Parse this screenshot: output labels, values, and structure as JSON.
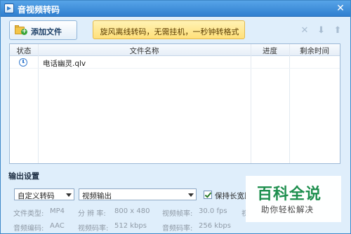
{
  "window": {
    "title": "音视频转码",
    "close_glyph": "✕"
  },
  "toolbar": {
    "add_button_label": "添加文件",
    "promo_text": "旋风离线转码，无需挂机，一秒钟转格式",
    "icons": [
      "delete-icon",
      "move-down-icon",
      "move-up-icon"
    ],
    "icon_glyphs": [
      "✕",
      "⬇",
      "⬆"
    ]
  },
  "file_list": {
    "columns": [
      "状态",
      "文件名称",
      "进度",
      "剩余时间"
    ],
    "rows": [
      {
        "status_icon": "clock-icon",
        "name": "电话幽灵.qlv",
        "progress": "",
        "remaining": ""
      }
    ]
  },
  "output": {
    "section_title": "输出设置",
    "mode_select": "自定义转码",
    "format_select": "视频输出",
    "keep_aspect_label": "保持长宽比",
    "keep_aspect_checked": true,
    "params": {
      "row1": [
        {
          "key": "文件类型:",
          "value": "MP4"
        },
        {
          "key": "分 辨 率:",
          "value": "800 x 480"
        },
        {
          "key": "视频帧率:",
          "value": "30.0 fps"
        },
        {
          "key": "视",
          "value": ""
        }
      ],
      "row2": [
        {
          "key": "音频编码:",
          "value": "AAC"
        },
        {
          "key": "视频码率:",
          "value": "512 kbps"
        },
        {
          "key": "音频码率:",
          "value": "256 kbps"
        },
        {
          "key": "",
          "value": ""
        }
      ]
    }
  },
  "watermark": {
    "title": "百科全说",
    "subtitle": "助你轻松解决"
  },
  "colors": {
    "titlebar": "#3a89d6",
    "window_bg": "#dfeefb",
    "promo_bg": "#ffe07a",
    "watermark_green": "#1e8f4e"
  }
}
